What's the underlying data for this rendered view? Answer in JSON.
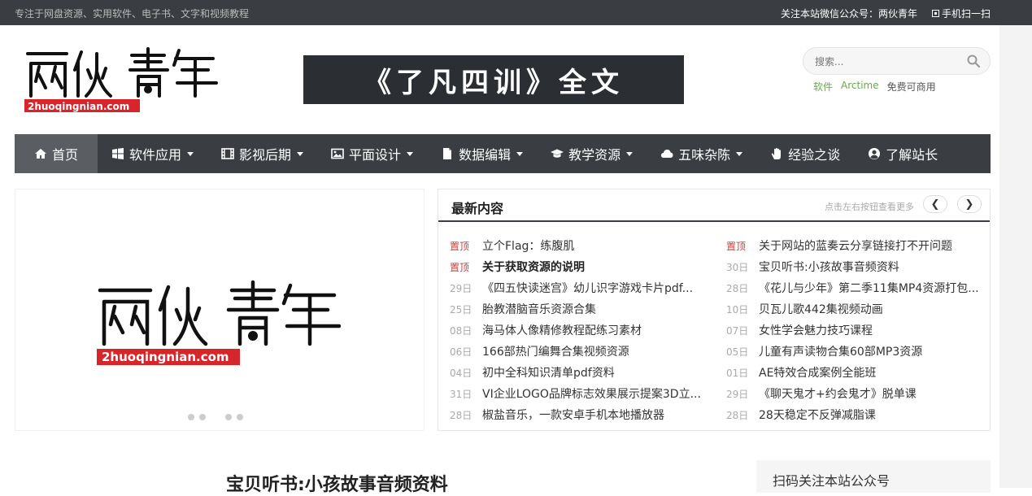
{
  "topbar": {
    "tagline": "专注于网盘资源、实用软件、电子书、文字和视频教程",
    "wechat": "关注本站微信公众号：两伙青年",
    "mobile": "手机扫一扫"
  },
  "logo": {
    "domain": "2huoqingnian.com"
  },
  "banner": {
    "text": "《了凡四训》全文"
  },
  "search": {
    "placeholder": "搜索..."
  },
  "hotwords": [
    "软件",
    "Arctime",
    "免费可商用"
  ],
  "nav": [
    {
      "label": "首页",
      "icon": "home-icon",
      "dropdown": false
    },
    {
      "label": "软件应用",
      "icon": "windows-icon",
      "dropdown": true
    },
    {
      "label": "影视后期",
      "icon": "film-icon",
      "dropdown": true
    },
    {
      "label": "平面设计",
      "icon": "image-icon",
      "dropdown": true
    },
    {
      "label": "数据编辑",
      "icon": "file-icon",
      "dropdown": true
    },
    {
      "label": "教学资源",
      "icon": "graduation-cap-icon",
      "dropdown": true
    },
    {
      "label": "五味杂陈",
      "icon": "cloud-icon",
      "dropdown": true
    },
    {
      "label": "经验之谈",
      "icon": "hand-icon",
      "dropdown": false
    },
    {
      "label": "了解站长",
      "icon": "user-circle-icon",
      "dropdown": false
    }
  ],
  "latest": {
    "title": "最新内容",
    "hint": "点击左右按钮查看更多",
    "left": [
      {
        "date": "置顶",
        "text": "立个Flag：练腹肌",
        "top": true,
        "bold": false
      },
      {
        "date": "置顶",
        "text": "关于获取资源的说明",
        "top": true,
        "bold": true
      },
      {
        "date": "29日",
        "text": "《四五快读迷宫》幼儿识字游戏卡片pdf...",
        "top": false,
        "bold": false
      },
      {
        "date": "25日",
        "text": "胎教潜脑音乐资源合集",
        "top": false,
        "bold": false
      },
      {
        "date": "08日",
        "text": "海马体人像精修教程配练习素材",
        "top": false,
        "bold": false
      },
      {
        "date": "06日",
        "text": "166部热门编舞合集视频资源",
        "top": false,
        "bold": false
      },
      {
        "date": "04日",
        "text": "初中全科知识清单pdf资料",
        "top": false,
        "bold": false
      },
      {
        "date": "31日",
        "text": "VI企业LOGO品牌标志效果展示提案3D立...",
        "top": false,
        "bold": false
      },
      {
        "date": "28日",
        "text": "椒盐音乐，一款安卓手机本地播放器",
        "top": false,
        "bold": false
      }
    ],
    "right": [
      {
        "date": "置顶",
        "text": "关于网站的蓝奏云分享链接打不开问题",
        "top": true,
        "bold": false
      },
      {
        "date": "30日",
        "text": "宝贝听书:小孩故事音频资料",
        "top": false,
        "bold": false
      },
      {
        "date": "28日",
        "text": "《花儿与少年》第二季11集MP4资源打包...",
        "top": false,
        "bold": false
      },
      {
        "date": "10日",
        "text": "贝瓦儿歌442集视频动画",
        "top": false,
        "bold": false
      },
      {
        "date": "07日",
        "text": "女性学会魅力技巧课程",
        "top": false,
        "bold": false
      },
      {
        "date": "05日",
        "text": "儿童有声读物合集60部MP3资源",
        "top": false,
        "bold": false
      },
      {
        "date": "01日",
        "text": "AE特效合成案例全能班",
        "top": false,
        "bold": false
      },
      {
        "date": "29日",
        "text": "《聊天鬼才+约会鬼才》脱单课",
        "top": false,
        "bold": false
      },
      {
        "date": "28日",
        "text": "28天稳定不反弹减脂课",
        "top": false,
        "bold": false
      }
    ]
  },
  "article": {
    "title": "宝贝听书:小孩故事音频资料"
  },
  "sidebar": {
    "qr_title": "扫码关注本站公众号"
  },
  "colors": {
    "nav_bg": "#3a3d41",
    "nav_active": "#5a5e63",
    "logo_red": "#d7262b",
    "hot_green": "#6aa84f",
    "pin_red": "#d23b3b"
  }
}
